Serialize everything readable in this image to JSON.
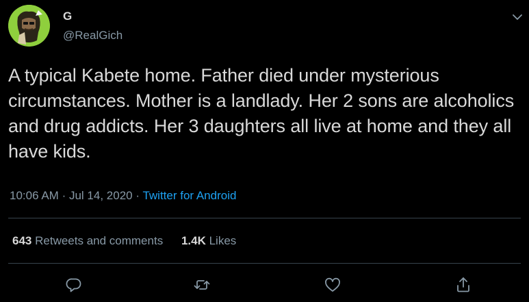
{
  "author": {
    "name": "G",
    "handle": "@RealGich"
  },
  "tweet": {
    "text": "A typical Kabete home. Father died under mysterious circumstances. Mother is a landlady. Her 2 sons are alcoholics and drug addicts. Her 3 daughters all live at home and they all have kids.",
    "time": "10:06 AM",
    "separator1": "·",
    "date": "Jul 14, 2020",
    "separator2": "·",
    "source": "Twitter for Android"
  },
  "stats": {
    "retweets_count": "643",
    "retweets_label": "Retweets and comments",
    "likes_count": "1.4K",
    "likes_label": "Likes"
  },
  "icons": {
    "more": "chevron-down-icon",
    "reply": "reply-icon",
    "retweet": "retweet-icon",
    "like": "heart-icon",
    "share": "share-icon"
  },
  "colors": {
    "background": "#000000",
    "text": "#d9d9d9",
    "secondary": "#8899a6",
    "link": "#1da1f2",
    "divider": "#38444d"
  }
}
